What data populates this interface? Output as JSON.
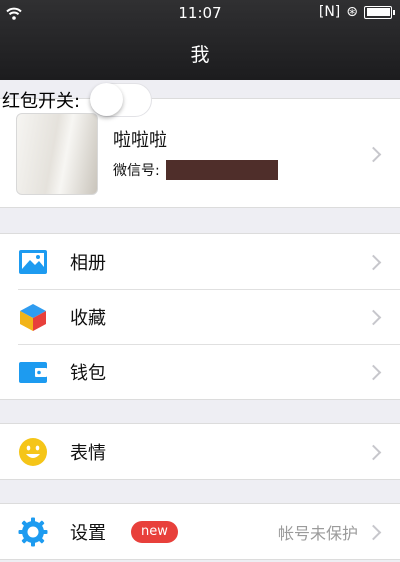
{
  "status_bar": {
    "time": "11:07",
    "carrier_tag": "[N]",
    "lock_symbol": "⊛"
  },
  "nav": {
    "title": "我"
  },
  "red_packet": {
    "label": "红包开关:",
    "enabled": false
  },
  "profile": {
    "nickname": "啦啦啦",
    "wechat_id_label": "微信号:"
  },
  "menu_groups": [
    [
      {
        "label": "相册",
        "icon": "photo-album-icon"
      },
      {
        "label": "收藏",
        "icon": "favorites-cube-icon"
      },
      {
        "label": "钱包",
        "icon": "wallet-icon"
      }
    ],
    [
      {
        "label": "表情",
        "icon": "smiley-icon"
      }
    ],
    [
      {
        "label": "设置",
        "icon": "settings-gear-icon",
        "badge": "new",
        "hint": "帐号未保护"
      }
    ]
  ],
  "colors": {
    "nav_bg": "#1c1c1e",
    "page_bg": "#eeeef3",
    "badge_red": "#e8403b",
    "icon_blue": "#1d9bf0"
  }
}
